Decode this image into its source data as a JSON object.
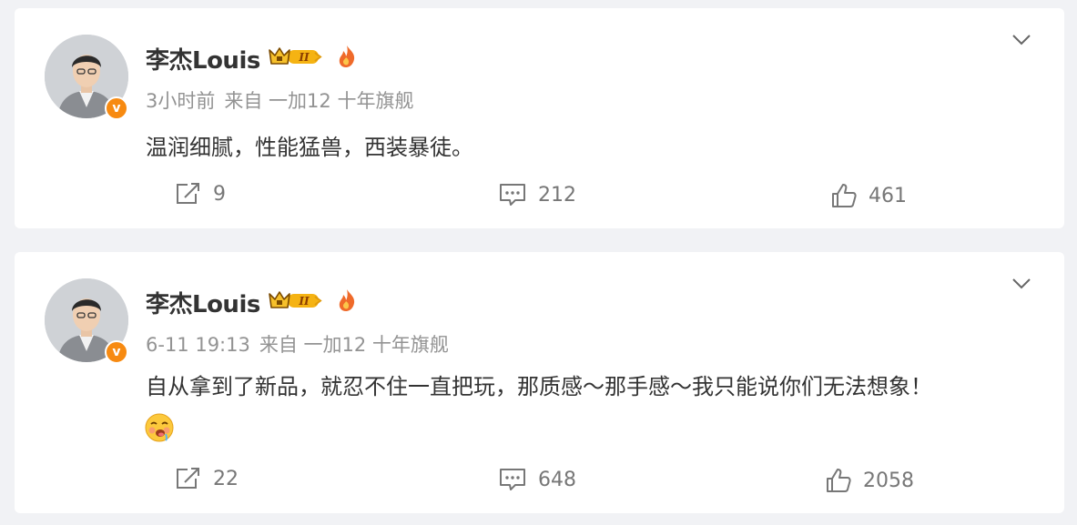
{
  "posts": [
    {
      "author": "李杰Louis",
      "time": "3小时前",
      "source": "来自 一加12 十年旗舰",
      "text": "温润细腻，性能猛兽，西装暴徒。",
      "has_emoji": false,
      "reposts": "9",
      "comments": "212",
      "likes": "461"
    },
    {
      "author": "李杰Louis",
      "time": "6-11 19:13",
      "source": "来自 一加12 十年旗舰",
      "text": "自从拿到了新品，就忍不住一直把玩，那质感～那手感～我只能说你们无法想象！",
      "has_emoji": true,
      "reposts": "22",
      "comments": "648",
      "likes": "2058"
    }
  ],
  "badges": {
    "vip_text": "II",
    "verified_mark": "v"
  },
  "colors": {
    "background": "#f1f2f5",
    "card": "#ffffff",
    "meta_text": "#939393",
    "action_text": "#777777",
    "verified_badge": "#f78a11",
    "vip_gold": "#f5b313"
  },
  "icons": {
    "repost": "repost-icon",
    "comment": "comment-icon",
    "like": "thumbs-up-icon",
    "more": "chevron-down-icon",
    "fire": "fire-badge-icon",
    "vip": "crown-vip-icon",
    "emoji": "drooling-face-emoji"
  }
}
